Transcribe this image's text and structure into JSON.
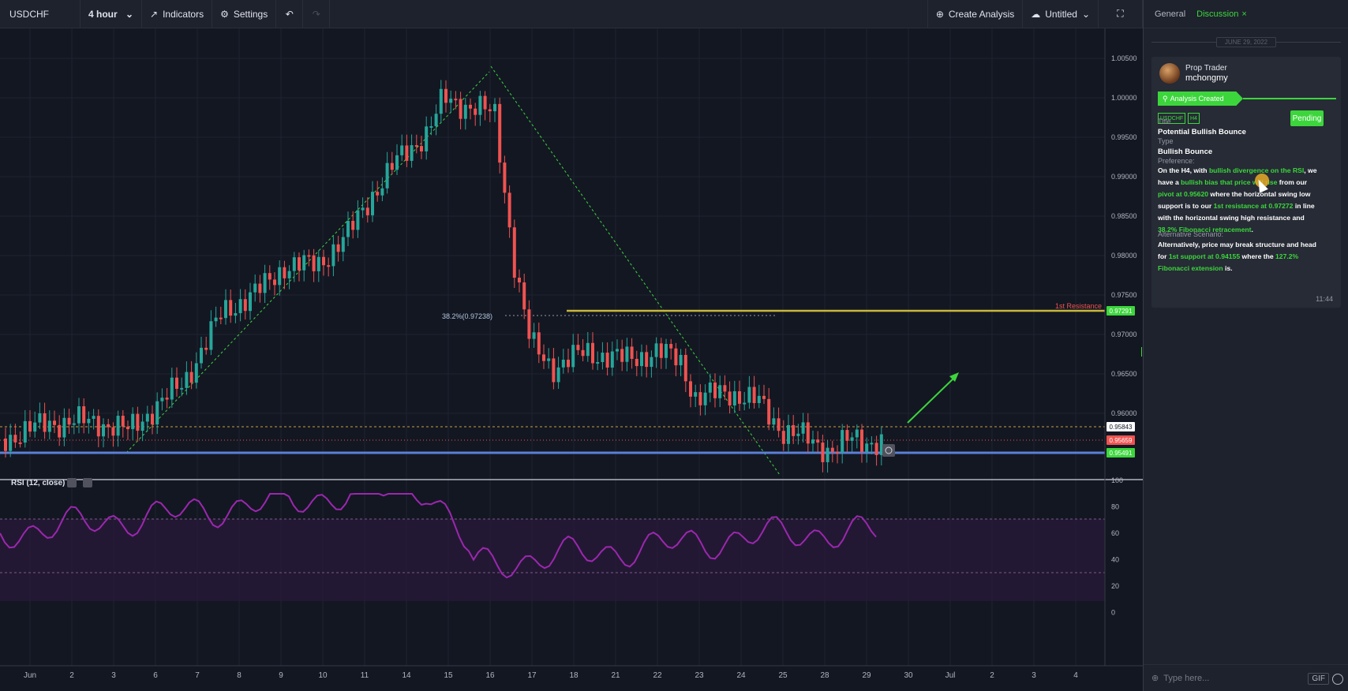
{
  "toolbar": {
    "symbol": "USDCHF",
    "interval": "4 hour",
    "indicators": "Indicators",
    "settings": "Settings",
    "create_analysis": "Create Analysis",
    "layout_name": "Untitled"
  },
  "panel": {
    "tabs": [
      "General",
      "Discussion"
    ],
    "active_tab": "Discussion",
    "date": "JUNE 29, 2022",
    "card": {
      "role": "Prop Trader",
      "user": "mchongmy",
      "status_banner": "Analysis Created",
      "tags": [
        "USDCHF",
        "H4"
      ],
      "status": "Pending",
      "title_label": "Title",
      "title": "Potential Bullish Bounce",
      "type_label": "Type",
      "type": "Bullish Bounce",
      "pref_label": "Preference:",
      "alt_label": "Alternative Scenario:",
      "time": "11:44"
    },
    "input_placeholder": "Type here...",
    "gif": "GIF"
  },
  "chart": {
    "price_ticks": [
      "1.00500",
      "1.00000",
      "0.99500",
      "0.99000",
      "0.98500",
      "0.98000",
      "0.97500",
      "0.97000",
      "0.96500",
      "0.96000"
    ],
    "price_badges": {
      "resistance": "0.97291",
      "dash": "0.95843",
      "current": "0.95659",
      "pivot": "0.95491"
    },
    "fib_label": "38.2%(0.97238)",
    "resistance_label": "1st Resistance",
    "x_ticks": [
      "Jun",
      "2",
      "3",
      "6",
      "7",
      "8",
      "9",
      "10",
      "11",
      "14",
      "15",
      "16",
      "17",
      "18",
      "21",
      "22",
      "23",
      "24",
      "25",
      "28",
      "29",
      "30",
      "Jul",
      "2",
      "3",
      "4"
    ],
    "rsi_label": "RSI (12, close)",
    "rsi_ticks": [
      "100",
      "80",
      "60",
      "40",
      "20",
      "0"
    ]
  },
  "colors": {
    "accent": "#3cd63c",
    "bull": "#26a69a",
    "bear": "#ef5350",
    "rsi": "#9c27b0",
    "pivot": "#5b7fd6"
  }
}
